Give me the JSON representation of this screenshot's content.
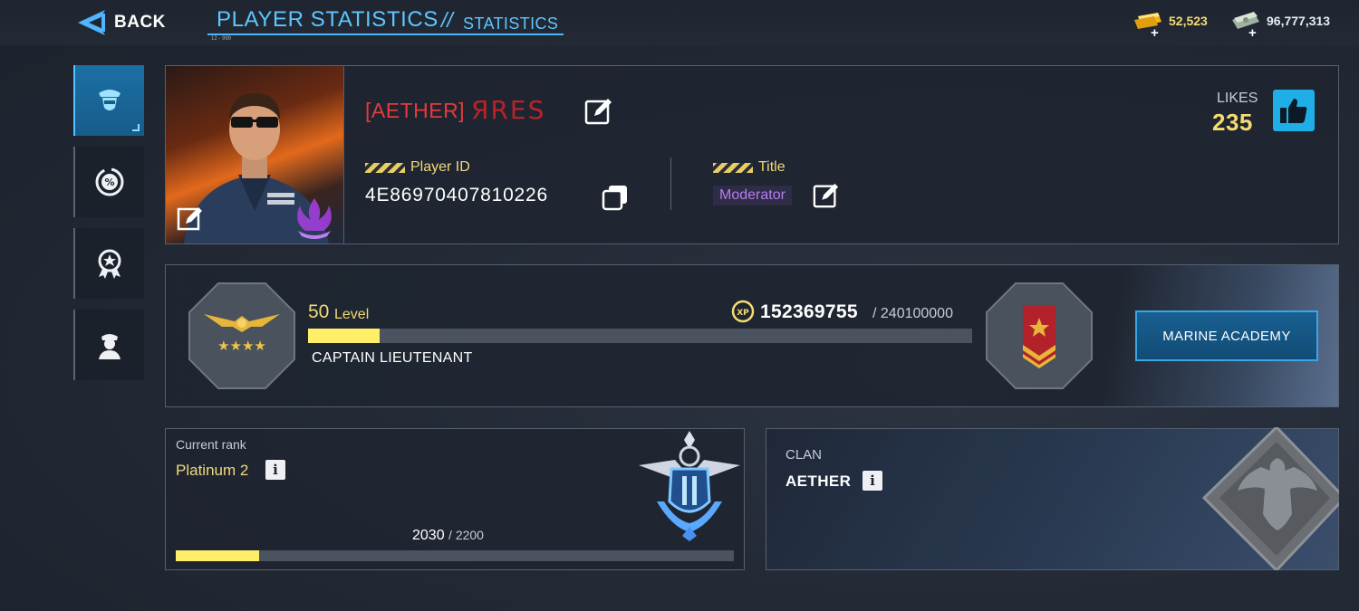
{
  "header": {
    "back_label": "BACK",
    "title": "PLAYER STATISTICS",
    "separator": "//",
    "subtitle": "STATISTICS",
    "tiny_text": "12 - 999"
  },
  "currencies": [
    {
      "icon": "gold-bar-icon",
      "value": "52,523",
      "color": "#f3dc72"
    },
    {
      "icon": "cash-icon",
      "value": "96,777,313",
      "color": "#e8ecf0"
    }
  ],
  "sidebar": {
    "tabs": [
      {
        "name": "profile-tab",
        "icon": "officer-icon",
        "active": true
      },
      {
        "name": "statistics-tab",
        "icon": "percent-icon",
        "active": false
      },
      {
        "name": "achievements-tab",
        "icon": "medal-icon",
        "active": false
      },
      {
        "name": "crew-tab",
        "icon": "soldier-icon",
        "active": false
      }
    ]
  },
  "profile": {
    "clan_tag": "[AETHER]",
    "name_glyphs": "ЯRES",
    "player_id_label": "Player ID",
    "player_id": "4E86970407810226",
    "title_label": "Title",
    "title_value": "Moderator",
    "likes_label": "LIKES",
    "likes_value": "235"
  },
  "level": {
    "number": "50",
    "word": "Level",
    "rank_name": "CAPTAIN LIEUTENANT",
    "xp_current": "152369755",
    "xp_max": "/ 240100000",
    "xp_fraction": 0.108,
    "academy_button": "MARINE ACADEMY"
  },
  "ranked": {
    "label": "Current rank",
    "value": "Platinum 2",
    "progress_current": "2030",
    "progress_max": "/ 2200",
    "progress_fraction": 0.15
  },
  "clan": {
    "label": "CLAN",
    "name": "AETHER"
  },
  "colors": {
    "accent_blue": "#5ec6ff",
    "gold": "#f1d97a",
    "bar_fill": "#ffee6a",
    "name_red": "#e23c3c",
    "moderator_purple": "#b37ded"
  }
}
